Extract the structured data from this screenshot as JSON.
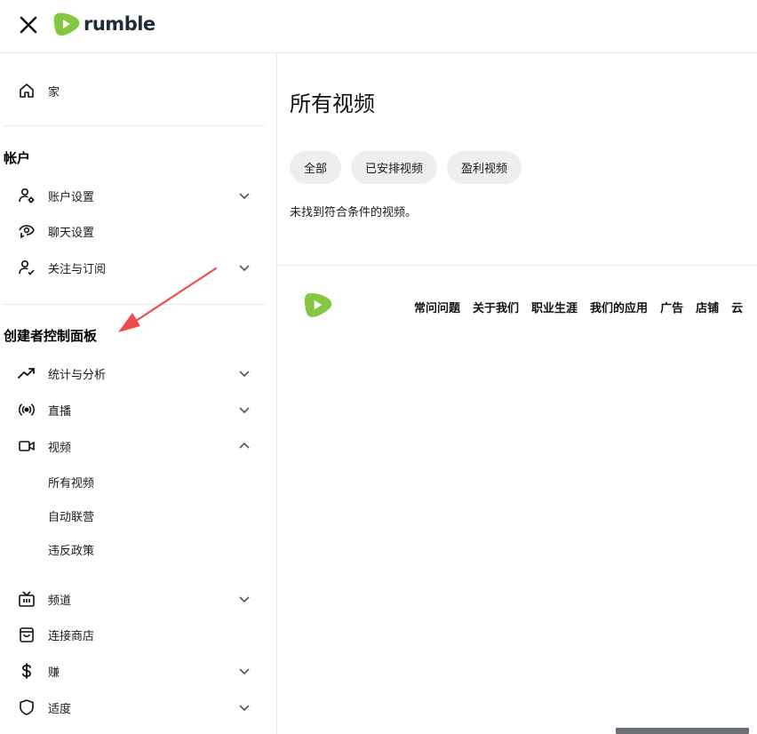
{
  "header": {
    "logo_text": "rumble",
    "close_icon": "close-icon",
    "brand_color": "#85c742"
  },
  "sidebar": {
    "home": {
      "label": "家",
      "icon": "home-icon"
    },
    "account_section": {
      "title": "帐户",
      "items": [
        {
          "label": "账户设置",
          "icon": "user-gear-icon",
          "expandable": true
        },
        {
          "label": "聊天设置",
          "icon": "eye-chat-icon",
          "expandable": false
        },
        {
          "label": "关注与订阅",
          "icon": "user-check-icon",
          "expandable": true
        }
      ]
    },
    "creator_section": {
      "title": "创建者控制面板",
      "items": [
        {
          "label": "统计与分析",
          "icon": "trending-up-icon",
          "expandable": true
        },
        {
          "label": "直播",
          "icon": "broadcast-icon",
          "expandable": true
        },
        {
          "label": "视频",
          "icon": "video-camera-icon",
          "expandable": true,
          "expanded": true,
          "subitems": [
            "所有视频",
            "自动联营",
            "违反政策"
          ]
        },
        {
          "label": "频道",
          "icon": "tv-icon",
          "expandable": true
        },
        {
          "label": "连接商店",
          "icon": "shopping-bag-icon",
          "expandable": false
        },
        {
          "label": "赚",
          "icon": "dollar-icon",
          "expandable": true
        },
        {
          "label": "适度",
          "icon": "shield-icon",
          "expandable": true
        }
      ]
    }
  },
  "main": {
    "title": "所有视频",
    "filters": [
      "全部",
      "已安排视频",
      "盈利视频"
    ],
    "empty_message": "未找到符合条件的视频。"
  },
  "footer": {
    "links": [
      "常问问题",
      "关于我们",
      "职业生涯",
      "我们的应用",
      "广告",
      "店铺",
      "云"
    ]
  },
  "annotation": {
    "arrow_color": "#ee4b4b"
  }
}
